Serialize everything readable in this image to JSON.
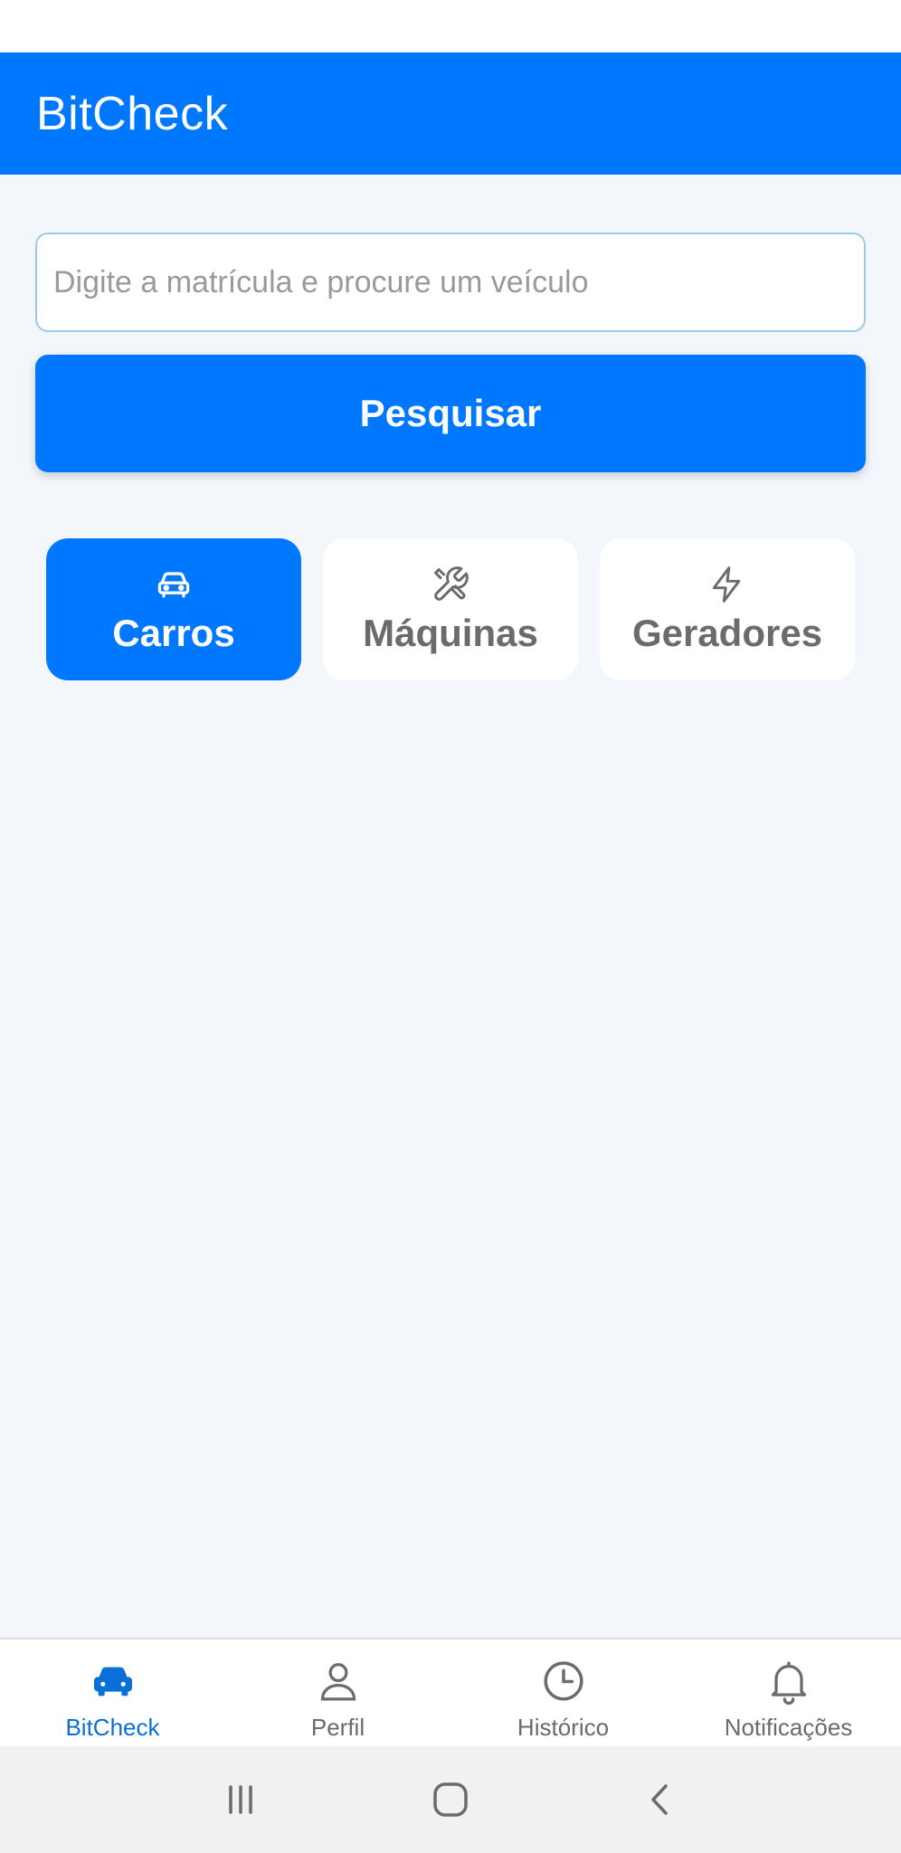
{
  "header": {
    "title": "BitCheck"
  },
  "search": {
    "placeholder": "Digite a matrícula e procure um veículo",
    "value": "",
    "button_label": "Pesquisar"
  },
  "categories": [
    {
      "label": "Carros",
      "icon": "car-icon",
      "selected": true
    },
    {
      "label": "Máquinas",
      "icon": "tools-icon",
      "selected": false
    },
    {
      "label": "Geradores",
      "icon": "lightning-icon",
      "selected": false
    }
  ],
  "bottom_nav": [
    {
      "label": "BitCheck",
      "icon": "car-icon",
      "active": true
    },
    {
      "label": "Perfil",
      "icon": "user-icon",
      "active": false
    },
    {
      "label": "Histórico",
      "icon": "clock-icon",
      "active": false
    },
    {
      "label": "Notificações",
      "icon": "bell-icon",
      "active": false
    }
  ],
  "colors": {
    "primary": "#0077ff",
    "background": "#f3f7fb",
    "inactive_text": "#6b6b6b",
    "active_nav_text": "#0a6fd6"
  }
}
